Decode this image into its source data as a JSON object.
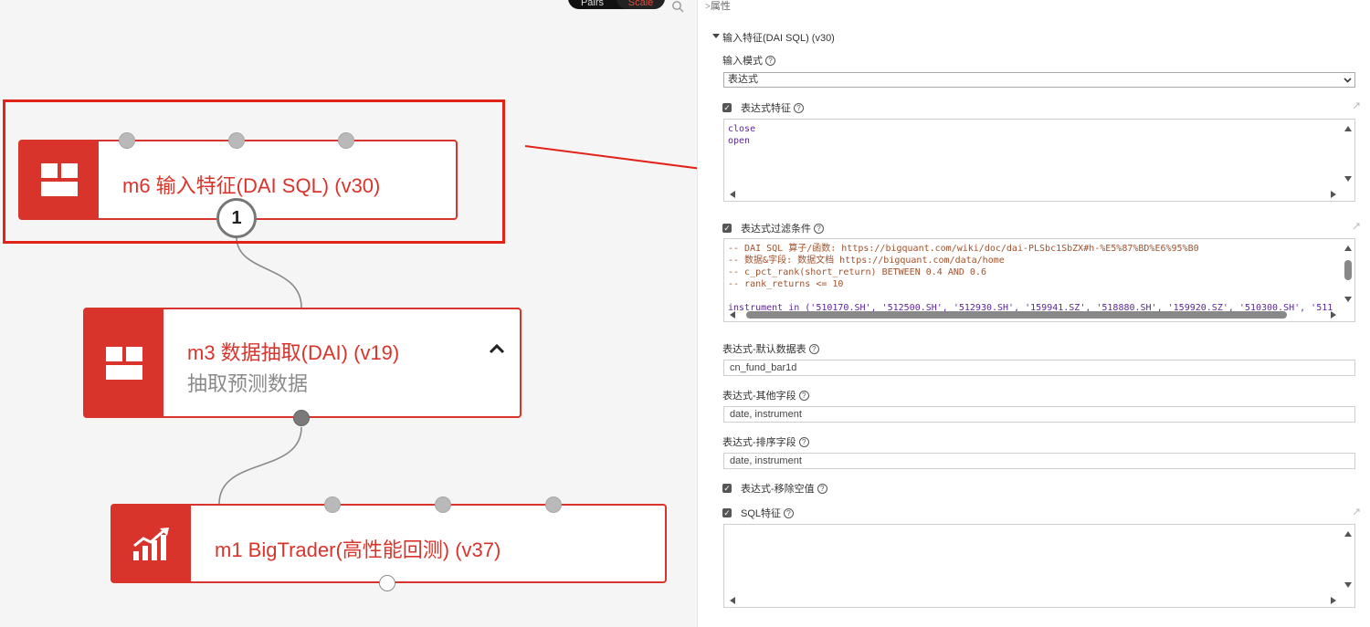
{
  "toolbar": {
    "toggle_left": "Pairs",
    "toggle_right": "Scale"
  },
  "canvas": {
    "nodes": [
      {
        "id": "m6",
        "title": "m6 输入特征(DAI SQL) (v30)",
        "icon": "grid-icon"
      },
      {
        "id": "m3",
        "title": "m3 数据抽取(DAI) (v19)",
        "subtitle": "抽取预测数据",
        "icon": "grid-icon"
      },
      {
        "id": "m1",
        "title": "m1 BigTrader(高性能回测) (v37)",
        "icon": "bar-chart-trend-icon"
      }
    ],
    "badge": "1",
    "colors": {
      "accent": "#d9342b",
      "highlight": "#e2231a"
    }
  },
  "props": {
    "panel_title": "属性",
    "section_title": "输入特征(DAI SQL) (v30)",
    "input_mode": {
      "label": "输入模式",
      "value": "表达式"
    },
    "expr_features": {
      "label": "表达式特征",
      "lines": [
        "close",
        "open"
      ]
    },
    "expr_filter": {
      "label": "表达式过滤条件",
      "lines": [
        "-- DAI SQL 算子/函数: https://bigquant.com/wiki/doc/dai-PLSbc1SbZX#h-%E5%87%BD%E6%95%B0",
        "-- 数据&字段: 数据文档 https://bigquant.com/data/home",
        "-- c_pct_rank(short_return) BETWEEN 0.4 AND 0.6",
        "-- rank_returns <= 10",
        "",
        "instrument in ('510170.SH', '512500.SH', '512930.SH', '159941.SZ', '518880.SH', '159920.SZ', '510300.SH', '511"
      ]
    },
    "default_table": {
      "label": "表达式-默认数据表",
      "value": "cn_fund_bar1d"
    },
    "other_fields": {
      "label": "表达式-其他字段",
      "value": "date, instrument"
    },
    "sort_fields": {
      "label": "表达式-排序字段",
      "value": "date, instrument"
    },
    "drop_na": {
      "label": "表达式-移除空值"
    },
    "sql_features": {
      "label": "SQL特征"
    }
  }
}
